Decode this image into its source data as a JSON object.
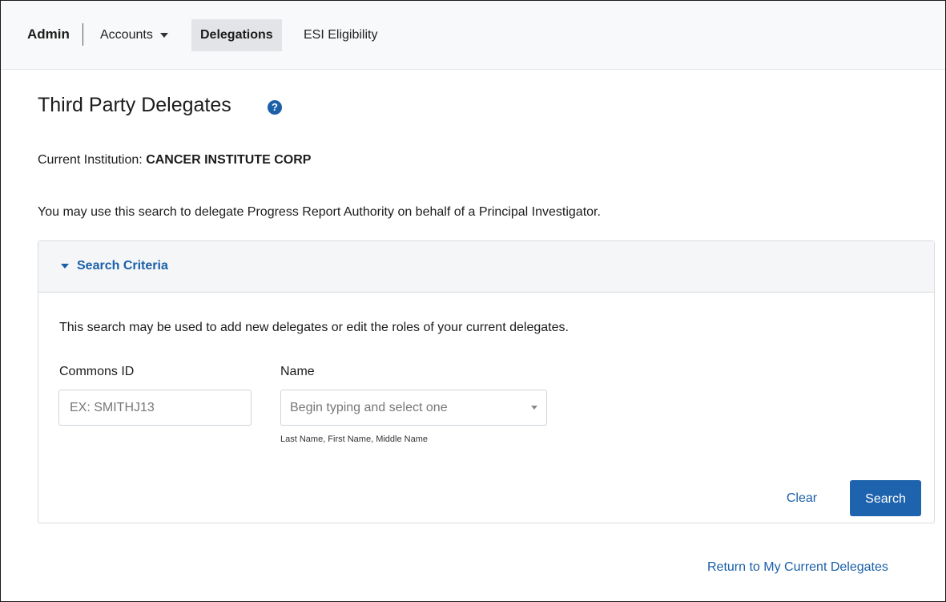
{
  "navbar": {
    "brand": "Admin",
    "items": [
      {
        "label": "Accounts",
        "has_dropdown": true,
        "active": false
      },
      {
        "label": "Delegations",
        "has_dropdown": false,
        "active": true
      },
      {
        "label": "ESI Eligibility",
        "has_dropdown": false,
        "active": false
      }
    ]
  },
  "page": {
    "title": "Third Party Delegates",
    "help_icon_glyph": "?",
    "institution_label": "Current Institution:",
    "institution_name": "CANCER INSTITUTE CORP",
    "intro": "You may use this search to delegate Progress Report Authority on behalf of a Principal Investigator."
  },
  "search_panel": {
    "title": "Search Criteria",
    "expanded": true,
    "description": "This search may be used to add new delegates or edit the roles of your current delegates.",
    "commons_id": {
      "label": "Commons ID",
      "placeholder": "EX: SMITHJ13",
      "value": ""
    },
    "name": {
      "label": "Name",
      "placeholder": "Begin typing and select one",
      "hint": "Last Name, First Name, Middle Name"
    },
    "clear_label": "Clear",
    "search_label": "Search"
  },
  "return_link": "Return to My Current Delegates",
  "colors": {
    "primary": "#1e63ad",
    "link": "#1a5fa8",
    "navbar_bg": "#f8f9fa",
    "active_tab_bg": "#e2e4e7"
  }
}
